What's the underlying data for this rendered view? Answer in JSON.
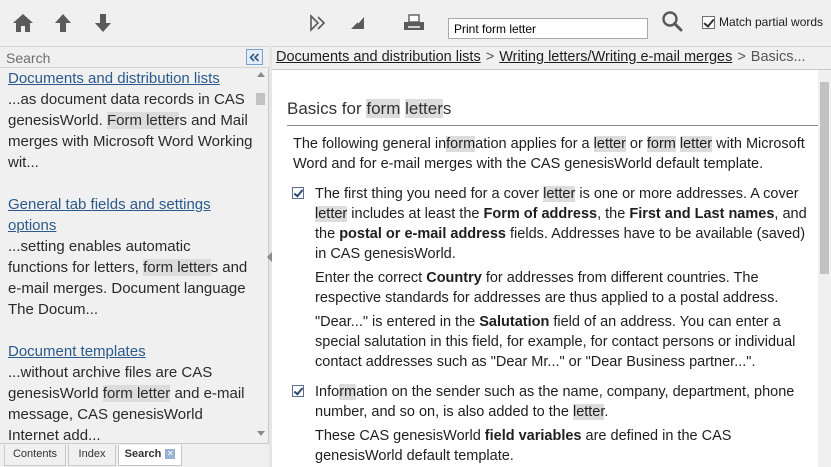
{
  "toolbar": {
    "search_value": "Print form letter",
    "match_partial_label": "Match partial words",
    "match_partial_checked": true
  },
  "left": {
    "header_title": "Search",
    "results": [
      {
        "title": "Documents and distribution lists",
        "snippet": [
          "...as document data records in CAS genesisWorld. ",
          {
            "hl": "Form letter"
          },
          "s and Mail merges with Microsoft Word Working wit..."
        ]
      },
      {
        "title": "General tab fields and settings options",
        "snippet": [
          "...setting enables automatic functions for letters, ",
          {
            "hl": "form letter"
          },
          "s and e-mail merges. Document language The Docum..."
        ]
      },
      {
        "title": "Document templates",
        "snippet": [
          "...without archive files are CAS genesisWorld ",
          {
            "hl": "form letter"
          },
          " and e-mail message, CAS genesisWorld Internet add..."
        ]
      }
    ],
    "tabs": [
      "Contents",
      "Index",
      "Search"
    ]
  },
  "breadcrumb": {
    "links": [
      "Documents and distribution lists",
      "Writing letters/Writing e-mail merges"
    ],
    "current": "Basics..."
  },
  "content": {
    "title": [
      "Basics for ",
      {
        "hl": "form"
      },
      " ",
      {
        "hl": "letter"
      },
      "s"
    ],
    "intro": [
      "The following general in",
      {
        "hl": "form"
      },
      "ation applies for a ",
      {
        "hl": "letter"
      },
      " or ",
      {
        "hl": "form"
      },
      " ",
      {
        "hl": "letter"
      },
      " with Microsoft Word and for e-mail merges with the CAS genesisWorld default template."
    ],
    "bullets": [
      {
        "paras": [
          [
            "The first thing you need for a cover ",
            {
              "hl": "letter"
            },
            " is one or more addresses. A cover ",
            {
              "hl": "letter"
            },
            " includes at least the ",
            {
              "b": "Form"
            },
            {
              "b": " of address"
            },
            ", the ",
            {
              "b": "First and Last names"
            },
            ", and the ",
            {
              "b": "postal or e-mail address"
            },
            " fields. Addresses have to be available (saved) in CAS genesisWorld."
          ],
          [
            "Enter the correct ",
            {
              "b": "Country"
            },
            " for addresses from different countries. The respective standards for addresses are thus applied to a postal address."
          ],
          [
            "\"Dear...\" is entered in the ",
            {
              "b": "Salutation"
            },
            " field of an address. You can enter a special salutation in this field, for example, for contact persons or individual contact addresses such as \"Dear Mr...\" or \"Dear Business partner...\"."
          ]
        ]
      },
      {
        "paras": [
          [
            "Info",
            {
              "hl": "rm"
            },
            "ation on the sender such as the name, company, department, phone number, and so on, is also added to the ",
            {
              "hl": "letter"
            },
            "."
          ],
          [
            "These CAS genesisWorld ",
            {
              "b": "field variables"
            },
            " are defined in the CAS genesisWorld default template."
          ]
        ]
      }
    ]
  }
}
